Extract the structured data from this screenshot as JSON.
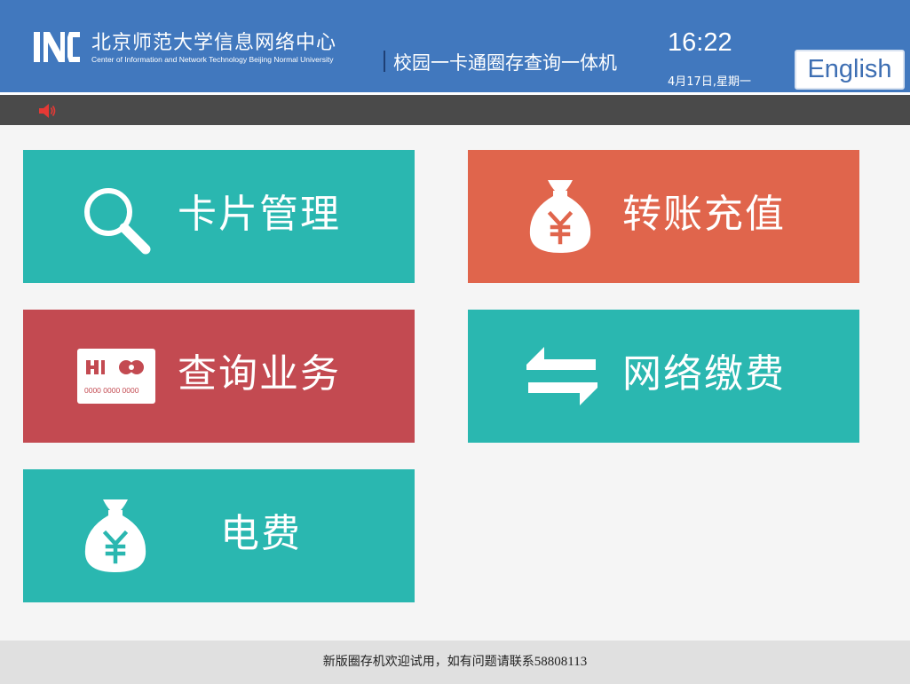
{
  "header": {
    "logo_mark": "INC",
    "org_name_cn": "北京师范大学信息网络中心",
    "org_name_en": "Center of Information and Network Technology Beijing Normal University",
    "app_title": "校园一卡通圈存查询一体机",
    "time": "16:22",
    "date": "4月17日,星期一",
    "language_button": "English"
  },
  "marquee": {
    "icon": "speaker-icon",
    "text": ""
  },
  "tiles": [
    {
      "label": "卡片管理",
      "icon": "search-icon",
      "color": "#2ab7b0"
    },
    {
      "label": "转账充值",
      "icon": "money-bag-icon",
      "color": "#e0654c"
    },
    {
      "label": "查询业务",
      "icon": "bank-card-icon",
      "color": "#c34a51",
      "card_number": "0000 0000 0000"
    },
    {
      "label": "网络缴费",
      "icon": "exchange-arrows-icon",
      "color": "#2ab7b0"
    },
    {
      "label": "电费",
      "icon": "money-bag-icon",
      "color": "#2ab7b0"
    }
  ],
  "footer": {
    "message": "新版圈存机欢迎试用，如有问题请联系",
    "phone": "58808113"
  },
  "colors": {
    "header": "#4178be",
    "bar": "#4a4a4a",
    "teal": "#2ab7b0",
    "orange": "#e0654c",
    "crimson": "#c34a51"
  }
}
